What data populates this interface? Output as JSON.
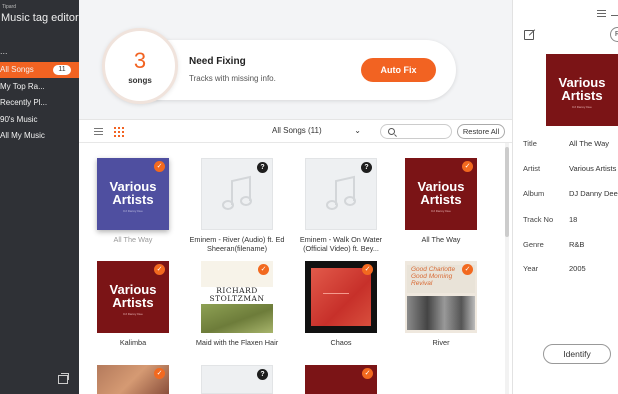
{
  "app": {
    "brand_small": "Tipard",
    "brand": "Music tag editor",
    "dots": "..."
  },
  "sidebar": {
    "items": [
      {
        "label": "All Songs",
        "count": "11",
        "active": true
      },
      {
        "label": "My Top Ra..."
      },
      {
        "label": "Recently Pl..."
      },
      {
        "label": "90's Music"
      },
      {
        "label": "All My Music"
      }
    ]
  },
  "fix": {
    "count": "3",
    "unit": "songs",
    "title": "Need Fixing",
    "desc": "Tracks with missing info.",
    "button": "Auto Fix"
  },
  "toolbar": {
    "dropdown": "All Songs (11)",
    "search_placeholder": "",
    "restore": "Restore All"
  },
  "songs": [
    {
      "title": "All The Way",
      "badge": "✓",
      "art": "Various Artists",
      "art_sub": "DJ Danny Dee"
    },
    {
      "title": "Eminem - River (Audio) ft. Ed Sheeran(filename)",
      "badge": "?"
    },
    {
      "title": "Eminem - Walk On Water (Official Video) ft. Bey...",
      "badge": "?"
    },
    {
      "title": "All The Way",
      "badge": "✓",
      "art": "Various Artists",
      "art_sub": "DJ Danny Dee"
    },
    {
      "title": "Kalimba",
      "badge": "✓",
      "art": "Various Artists",
      "art_sub": "DJ Danny Dee"
    },
    {
      "title": "Maid with the Flaxen Hair",
      "badge": "✓",
      "art": "RICHARD STOLTZMAN",
      "art_sub": "MAID WITH THE FLAXEN HAIR"
    },
    {
      "title": "Chaos",
      "badge": "✓"
    },
    {
      "title": "River",
      "badge": "✓",
      "art": "Good Charlotte Good Morning Revival"
    },
    {
      "badge": "✓"
    },
    {
      "badge": "?"
    },
    {
      "badge": "✓"
    }
  ],
  "details": {
    "art": "Various Artists",
    "art_sub": "DJ Danny Dee",
    "button_r": "R",
    "fields": [
      {
        "label": "Title",
        "value": "All The Way"
      },
      {
        "label": "Artist",
        "value": "Various Artists"
      },
      {
        "label": "Album",
        "value": "DJ Danny Dee"
      },
      {
        "label": "Track No",
        "value": "18"
      },
      {
        "label": "Genre",
        "value": "R&B"
      },
      {
        "label": "Year",
        "value": "2005"
      }
    ],
    "identify": "Identify"
  },
  "colors": {
    "accent": "#f26322",
    "sidebar": "#2f3136",
    "cover_red": "#7b1416",
    "cover_selected": "#4f4fa0"
  }
}
